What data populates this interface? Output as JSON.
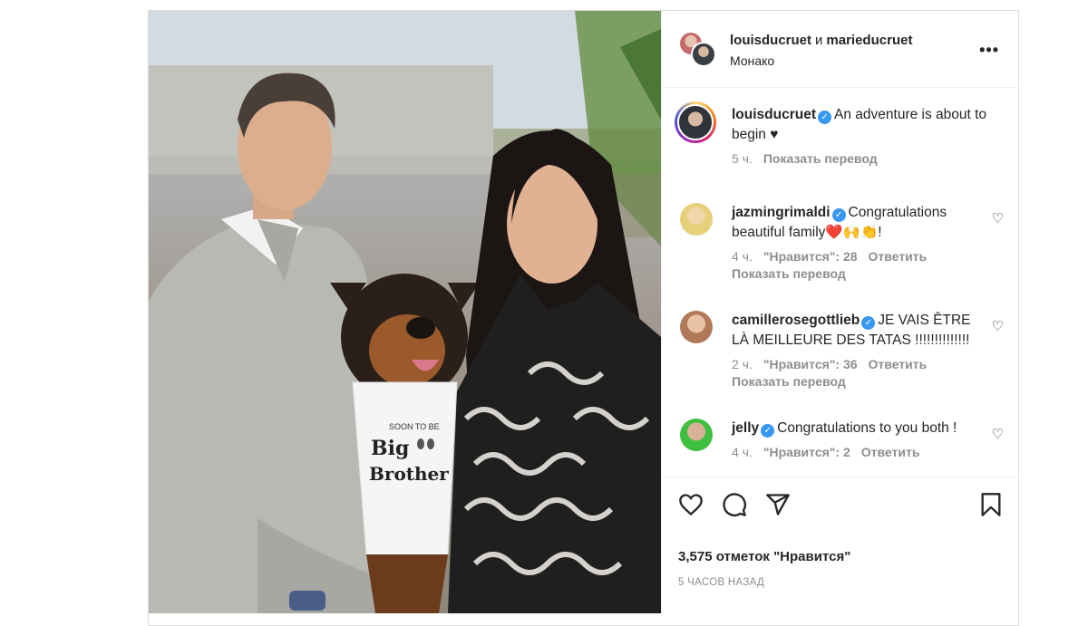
{
  "header": {
    "user1": "louisducruet",
    "conj": "и",
    "user2": "marieducruet",
    "location": "Монако"
  },
  "caption": {
    "user": "louisducruet",
    "text": "An adventure is about to begin ♥",
    "time": "5 ч.",
    "translate": "Показать перевод"
  },
  "comments": [
    {
      "user": "jazmingrimaldi",
      "text": "Congratulations beautiful family❤️🙌👏!",
      "time": "4 ч.",
      "likes": "\"Нравится\": 28",
      "reply": "Ответить",
      "translate": "Показать перевод",
      "avatar_color": "#e6d07a"
    },
    {
      "user": "camillerosegottlieb",
      "text": "JE VAIS ÊTRE LÀ MEILLEURE DES TATAS !!!!!!!!!!!!!!",
      "time": "2 ч.",
      "likes": "\"Нравится\": 36",
      "reply": "Ответить",
      "translate": "Показать перевод",
      "avatar_color": "#b07a5a"
    },
    {
      "user": "jelly",
      "text": "Congratulations to you both !",
      "time": "4 ч.",
      "likes": "\"Нравится\": 2",
      "reply": "Ответить",
      "avatar_color": "#3fbf3f"
    }
  ],
  "footer": {
    "likes": "3,575 отметок \"Нравится\"",
    "time": "5 ЧАСОВ НАЗАД"
  },
  "photo": {
    "shirt_line1": "SOON TO BE",
    "shirt_line2": "Big",
    "shirt_line3": "Brother"
  },
  "icons": [
    "more-icon",
    "heart-icon",
    "comment-icon",
    "share-icon",
    "bookmark-icon",
    "verified-icon"
  ]
}
